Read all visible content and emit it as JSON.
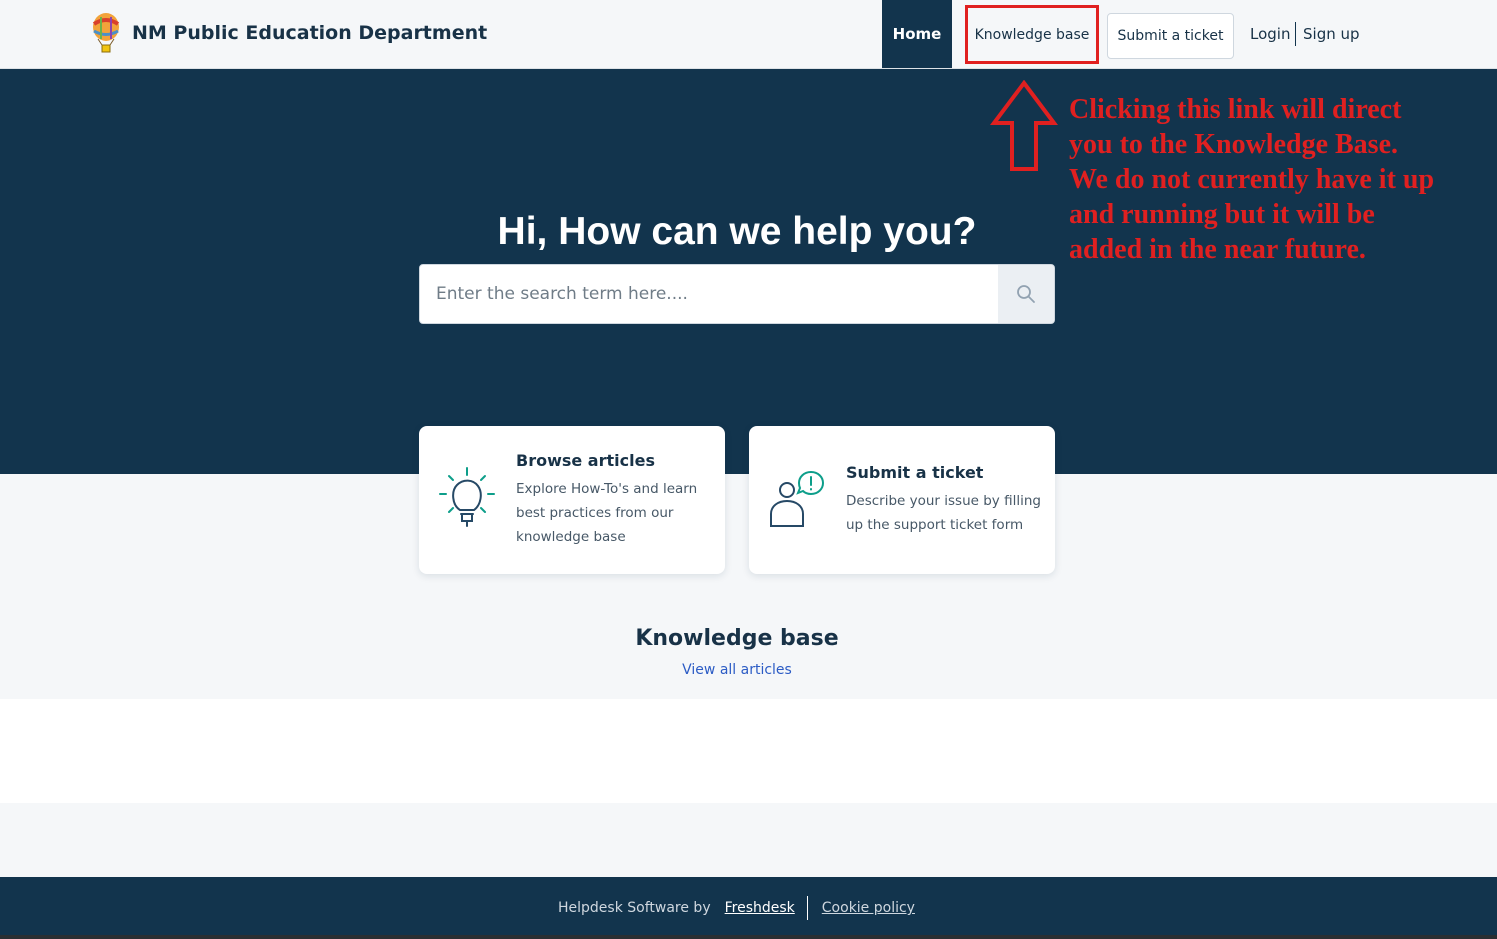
{
  "header": {
    "brand_name": "NM Public Education Department",
    "nav": {
      "home": "Home",
      "knowledge_base": "Knowledge base",
      "submit_ticket": "Submit a ticket",
      "login": "Login",
      "signup": "Sign up"
    }
  },
  "hero": {
    "title": "Hi, How can we help you?",
    "search_placeholder": "Enter the search term here....",
    "search_icon": "search-icon"
  },
  "annotation": {
    "lines": [
      "Clicking this link will direct",
      "you to the Knowledge Base.",
      "We do not currently have it up",
      "and running but it will be",
      "added in the near future."
    ],
    "color": "#e02020"
  },
  "cards": [
    {
      "title": "Browse articles",
      "desc": "Explore How-To's and learn best practices from our knowledge base",
      "icon": "lightbulb-icon"
    },
    {
      "title": "Submit a ticket",
      "desc": "Describe your issue by filling up the support ticket form",
      "icon": "user-alert-icon"
    }
  ],
  "knowledge_base": {
    "title": "Knowledge base",
    "link": "View all articles"
  },
  "footer": {
    "prefix": "Helpdesk Software by",
    "freshdesk": "Freshdesk",
    "cookie": "Cookie policy"
  },
  "colors": {
    "navy": "#12344d",
    "accent_green": "#0d9e8a",
    "link_blue": "#2c5cc5",
    "highlight_red": "#e02020"
  }
}
